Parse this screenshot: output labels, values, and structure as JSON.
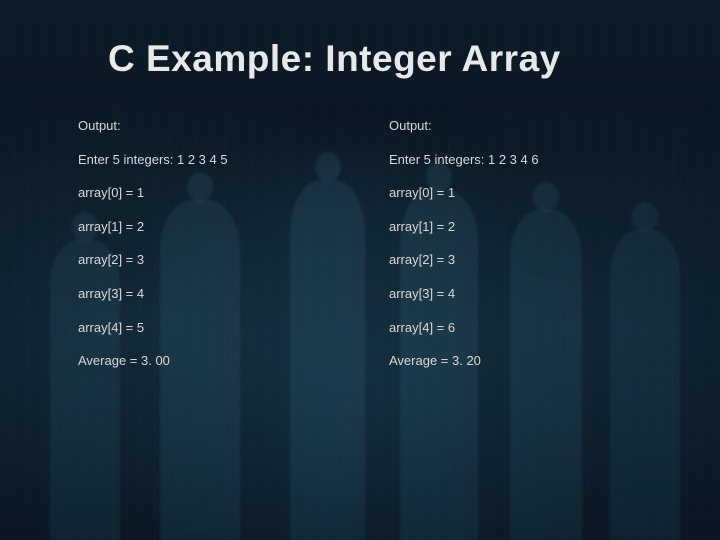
{
  "title": "C Example: Integer Array",
  "left": {
    "output_label": "Output:",
    "prompt": "Enter 5 integers:  1 2 3 4 5",
    "lines": [
      "array[0] = 1",
      "array[1] = 2",
      "array[2] = 3",
      "array[3] = 4",
      "array[4] = 5"
    ],
    "average": "Average = 3. 00"
  },
  "right": {
    "output_label": "Output:",
    "prompt": "Enter 5 integers:  1 2 3 4 6",
    "lines": [
      "array[0] = 1",
      "array[1] = 2",
      "array[2] = 3",
      "array[3] = 4",
      "array[4] = 6"
    ],
    "average": "Average = 3. 20"
  }
}
